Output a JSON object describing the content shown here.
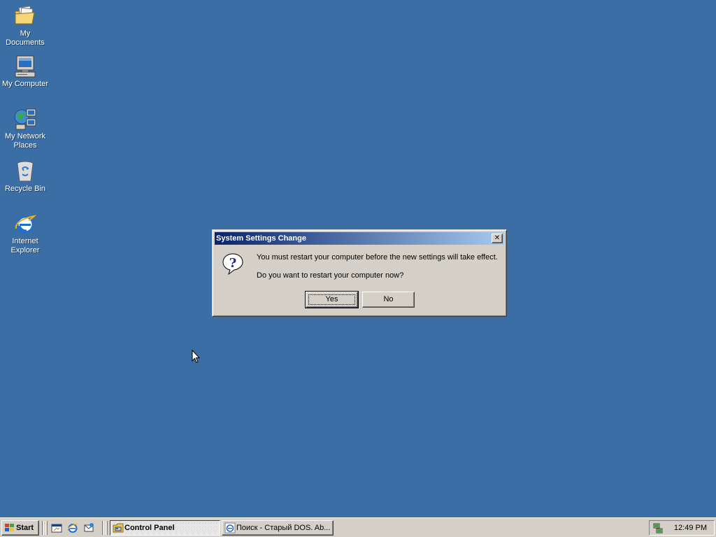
{
  "desktop": {
    "background_color": "#3a6ea5",
    "icons": [
      {
        "label": "My Documents",
        "icon": "my-documents-icon"
      },
      {
        "label": "My Computer",
        "icon": "my-computer-icon"
      },
      {
        "label": "My Network Places",
        "icon": "my-network-places-icon"
      },
      {
        "label": "Recycle Bin",
        "icon": "recycle-bin-icon"
      },
      {
        "label": "Internet Explorer",
        "icon": "internet-explorer-icon"
      }
    ]
  },
  "dialog": {
    "title": "System Settings Change",
    "icon": "question-icon",
    "message_line1": "You must restart your computer before the new settings will take effect.",
    "message_line2": "Do you want to restart your computer now?",
    "yes_label": "Yes",
    "no_label": "No",
    "close_icon": "close-icon"
  },
  "taskbar": {
    "start_label": "Start",
    "quick_launch": [
      "show-desktop-icon",
      "internet-explorer-icon",
      "outlook-express-icon"
    ],
    "tasks": [
      {
        "label": "Control Panel",
        "active": true,
        "icon": "control-panel-icon"
      },
      {
        "label": "Поиск - Старый DOS. Ab...",
        "active": false,
        "icon": "internet-explorer-icon"
      }
    ],
    "tray_icon": "network-tray-icon",
    "clock": "12:49 PM"
  }
}
